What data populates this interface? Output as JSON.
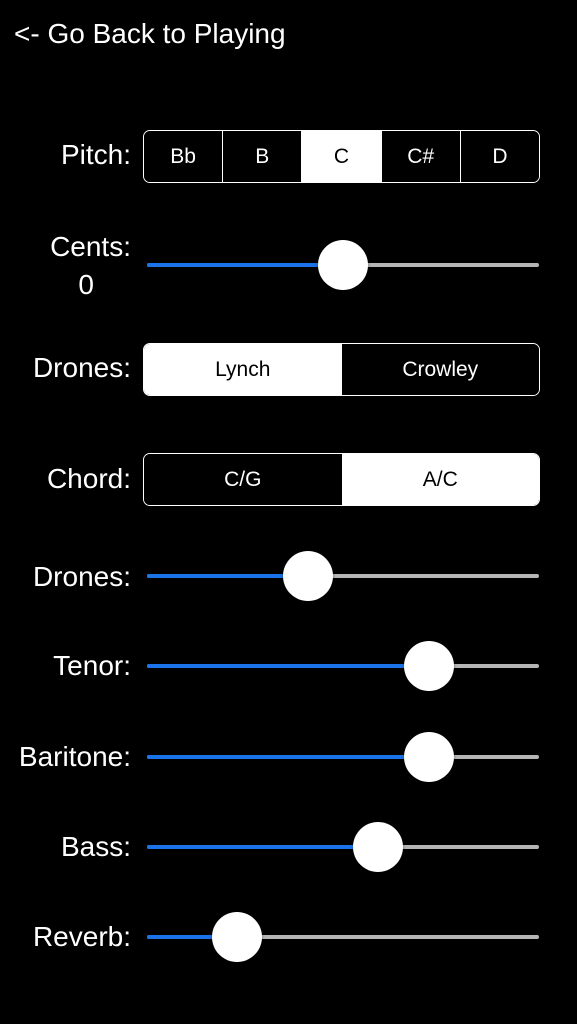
{
  "header": {
    "back_label": "<- Go Back to Playing"
  },
  "pitch": {
    "label": "Pitch:",
    "options": [
      "Bb",
      "B",
      "C",
      "C#",
      "D"
    ],
    "selected": "C"
  },
  "cents": {
    "label": "Cents:",
    "value_text": "0",
    "value": 0.5
  },
  "drone_type": {
    "label": "Drones:",
    "options": [
      "Lynch",
      "Crowley"
    ],
    "selected": "Lynch"
  },
  "chord": {
    "label": "Chord:",
    "options": [
      "C/G",
      "A/C"
    ],
    "selected": "A/C"
  },
  "volumes": [
    {
      "label": "Drones:",
      "value": 0.41
    },
    {
      "label": "Tenor:",
      "value": 0.72
    },
    {
      "label": "Baritone:",
      "value": 0.72
    },
    {
      "label": "Bass:",
      "value": 0.59
    },
    {
      "label": "Reverb:",
      "value": 0.23
    }
  ],
  "colors": {
    "accent": "#1a73e8",
    "track": "#b5b5b5",
    "background": "#000000"
  }
}
